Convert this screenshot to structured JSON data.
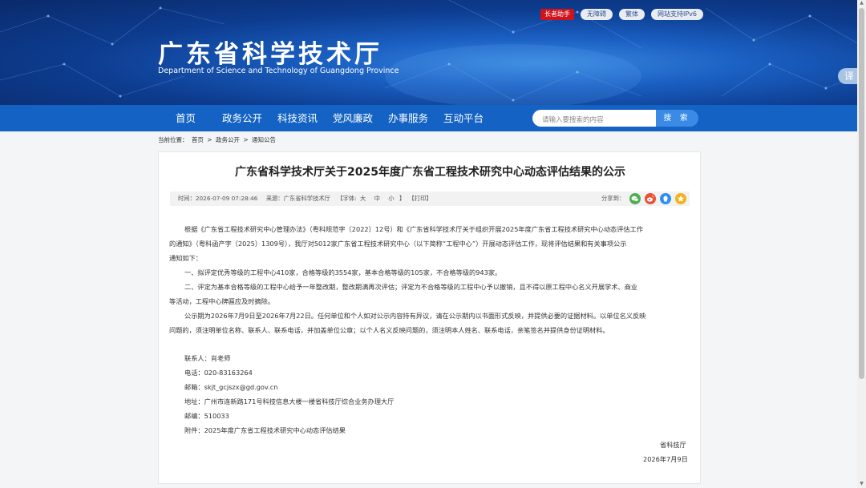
{
  "header": {
    "title": "广东省科学技术厅",
    "subtitle": "Department of Science and Technology of Guangdong Province",
    "tools": [
      "长者助手",
      "无障碍",
      "繁体",
      "网站支持IPv6"
    ],
    "translate_label": "译"
  },
  "nav": {
    "items": [
      "首页",
      "政务公开",
      "科技资讯",
      "党风廉政",
      "办事服务",
      "互动平台"
    ],
    "search_placeholder": "请输入要搜索的内容",
    "search_button": "搜 索"
  },
  "breadcrumb": {
    "prefix": "当前位置：",
    "items": [
      "首页",
      "政务公开",
      "通知公告"
    ],
    "separator": ">"
  },
  "article": {
    "title": "广东省科学技术厅关于2025年度广东省工程技术研究中心动态评估结果的公示",
    "meta": {
      "time": "时间：2026-07-09 07:28:46",
      "source": "来源：广东省科学技术厅",
      "font_label": "【字体:",
      "font_large": "大",
      "font_medium": "中",
      "font_small": "小",
      "font_close": "】",
      "print": "【打印】",
      "share_label": "分享到："
    },
    "share_icons": [
      "wechat-icon",
      "weibo-icon",
      "qq-icon",
      "favorite-icon"
    ],
    "lines": [
      "根据《广东省工程技术研究中心管理办法》（粤科规范字〔2022〕12号）和《广东省科学技术厅关于组织开展2025年度广东省工程技术研究中心动态评估工作",
      "的通知》（粤科函产字〔2025〕1309号），我厅对5012家广东省工程技术研究中心（以下简称“工程中心”）开展动态评估工作，现将评估结果和有关事项公示",
      "通知如下：",
      "一、拟评定优秀等级的工程中心410家，合格等级的3554家，基本合格等级的105家，不合格等级的943家。",
      "二、评定为基本合格等级的工程中心给予一年整改期，整改期满再次评估；评定为不合格等级的工程中心予以撤销，且不得以原工程中心名义开展学术、商业",
      "等活动，工程中心牌匾应及时摘除。",
      "公示期为2026年7月9日至2026年7月22日。任何单位和个人如对公示内容持有异议，请在公示期内以书面形式反映，并提供必要的证据材料。以单位名义反映",
      "问题的，须注明单位名称、联系人、联系电话，并加盖单位公章；以个人名义反映问题的，须注明本人姓名、联系电话，亲笔签名并提供身份证明材料。"
    ],
    "contact": [
      "联系人：肖老师",
      "电话：020-83163264",
      "邮箱：skjt_gcjszx@gd.gov.cn",
      "地址：广州市连新路171号科技信息大楼一楼省科技厅综合业务办理大厅",
      "邮编：510033",
      "附件：2025年度广东省工程技术研究中心动态评估结果"
    ],
    "signature": {
      "org": "省科技厅",
      "date": "2026年7月9日"
    }
  },
  "colors": {
    "nav_bg": "#1463c4",
    "search_btn": "#3b8be6",
    "badge_red": "#d0131b"
  }
}
